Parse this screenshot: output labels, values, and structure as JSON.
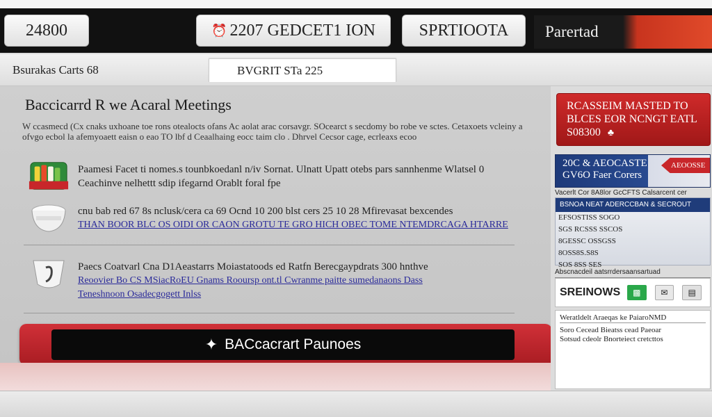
{
  "header": {
    "left_button": "24800",
    "center_button": "2207 GEDCET1 ION",
    "right_button": "SPRTIOOTA",
    "brand": "Parertad"
  },
  "subnav": {
    "left": "Bsurakas Carts 68",
    "active_tab": "BVGRIT STa 225"
  },
  "main": {
    "title": "Baccicarrd R we Acaral Meetings",
    "intro": "W ccasmecd (Cx cnaks uxhoane toe rons otealocts ofans Ac aolat arac corsavgr. SOcearct s secdomy bo robe ve sctes. Cetaxoets vcleiny a ofvgo ecbol la afemyoaett eaisn o eao TO lbf d Ceaalhaing eocc taim clo . Dhrvel Cecsor cage, ecrleaxs ecoo",
    "items": [
      {
        "text": "Paamesi Facet ti nomes.s tounbkoedanl n/iv Sornat. Ulnatt Upatt otebs pars sannhenme Wlatsel 0 Ceachinve nelhettt sdip ifegarnd Orablt foral fpe",
        "link": ""
      },
      {
        "text": "cnu bab red 67 8s nclusk/cera ca 69 Ocnd 10 200 blst cers 25 10 28 Mfirevasat bexcendes",
        "link": "THAN BOOR BLC OS OIDI OR CAON GROTU TE GRO HICH OBEC TOME NTEMDRCAGA HTARRE"
      },
      {
        "text": "Paecs Coatvarl Cna D1Aeastarrs Moiastatoods ed Ratfn Berecgaypdrats 300 hnthve",
        "link": "Reoovier Bo CS MSiacRoEU Gnams Rooursp ont.tl Cwranme paitte sumedanaons Dass",
        "link2": "Teneshnoon Osadecgogett Inlss"
      }
    ],
    "cta_label": "BACcacrart Paunoes"
  },
  "sidebar": {
    "promo": {
      "line1": "RCASSEIM MASTED TO",
      "line2": "BLCES EOR NCNGT EATL",
      "line3": "S08300"
    },
    "promo2": {
      "line1": "20C & AEOCASTE",
      "line2": "GV6O Faer Corers",
      "flag": "AEOOSSE"
    },
    "caption1": "Vacerlt Cor 8A8lor GcCFTS     Calsarcent cer",
    "stats": {
      "header": "BSNOA NEAT ADERCCBAN & SECROUT",
      "rows": [
        "EFSOSTISS SOGO",
        "SGS RCSSS SSCOS",
        "8GESSC OSSGSS",
        "8OSS8S.S8S",
        "SOS 8SS SES"
      ]
    },
    "caption2": "Abscnacdeil aatsrrdersaansartuad",
    "share_label": "SREINOWS",
    "news": {
      "title": "Weratldelt Araeqas ke PaiaroNMD",
      "lines": [
        "Soro Cecead Bieatss cead Paeoar",
        "Sotsud cdeolr Bnorteiect cretcttos"
      ]
    }
  },
  "colors": {
    "cta_red": "#c8262e",
    "promo_red": "#cf2a2a",
    "promo_blue": "#1e3a7a",
    "link_blue": "#2a2a9a"
  }
}
